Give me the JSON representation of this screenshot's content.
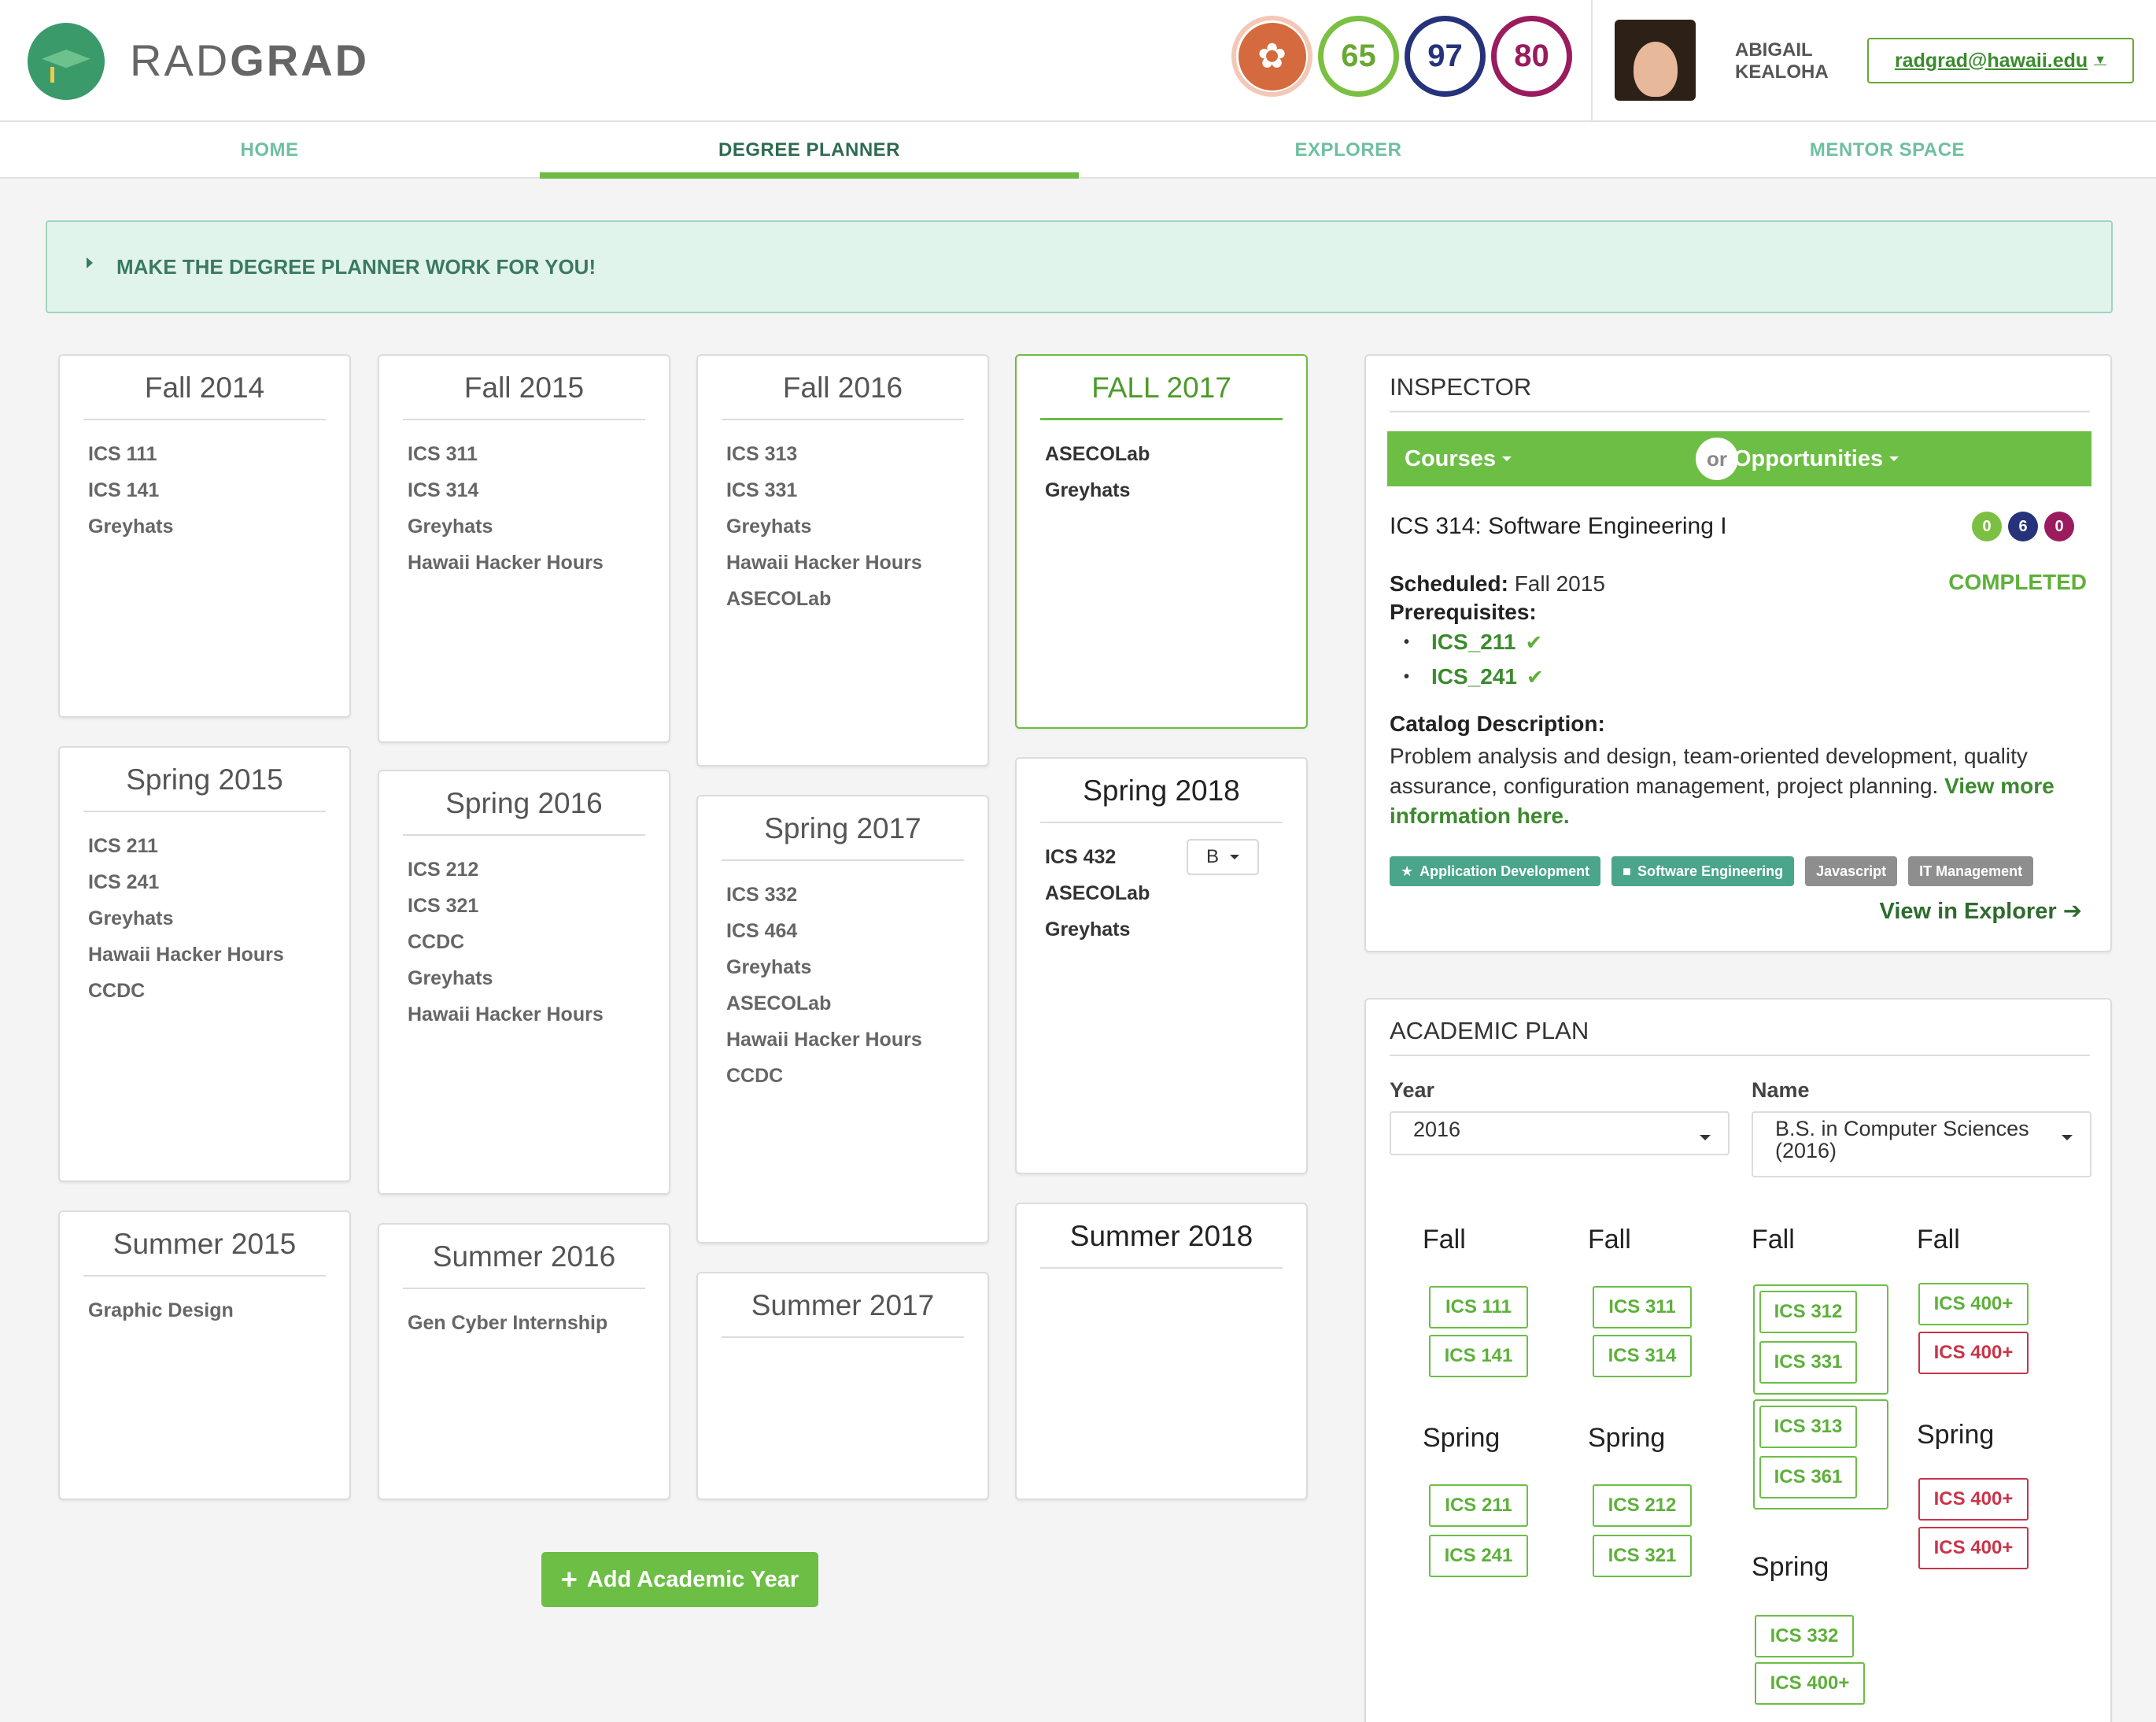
{
  "header": {
    "brand_light": "RAD",
    "brand_bold": "GRAD",
    "scores": {
      "innovation": "65",
      "competency": "97",
      "experience": "80"
    },
    "user_name": "ABIGAIL KEALOHA",
    "email": "radgrad@hawaii.edu"
  },
  "nav": [
    {
      "label": "HOME",
      "active": false
    },
    {
      "label": "DEGREE PLANNER",
      "active": true
    },
    {
      "label": "EXPLORER",
      "active": false
    },
    {
      "label": "MENTOR SPACE",
      "active": false
    }
  ],
  "banner": {
    "text": "MAKE THE DEGREE PLANNER WORK FOR YOU!"
  },
  "semesters": {
    "fall2014": {
      "title": "Fall 2014",
      "items": [
        "ICS 111",
        "ICS 141",
        "Greyhats"
      ]
    },
    "spring2015": {
      "title": "Spring 2015",
      "items": [
        "ICS 211",
        "ICS 241",
        "Greyhats",
        "Hawaii Hacker Hours",
        "CCDC"
      ]
    },
    "summer2015": {
      "title": "Summer 2015",
      "items": [
        "Graphic Design"
      ]
    },
    "fall2015": {
      "title": "Fall 2015",
      "items": [
        "ICS 311",
        "ICS 314",
        "Greyhats",
        "Hawaii Hacker Hours"
      ]
    },
    "spring2016": {
      "title": "Spring 2016",
      "items": [
        "ICS 212",
        "ICS 321",
        "CCDC",
        "Greyhats",
        "Hawaii Hacker Hours"
      ]
    },
    "summer2016": {
      "title": "Summer 2016",
      "items": [
        "Gen Cyber Internship"
      ]
    },
    "fall2016": {
      "title": "Fall 2016",
      "items": [
        "ICS 313",
        "ICS 331",
        "Greyhats",
        "Hawaii Hacker Hours",
        "ASECOLab"
      ]
    },
    "spring2017": {
      "title": "Spring 2017",
      "items": [
        "ICS 332",
        "ICS 464",
        "Greyhats",
        "ASECOLab",
        "Hawaii Hacker Hours",
        "CCDC"
      ]
    },
    "summer2017": {
      "title": "Summer 2017",
      "items": []
    },
    "fall2017": {
      "title": "FALL 2017",
      "items": [
        "ASECOLab",
        "Greyhats"
      ]
    },
    "spring2018": {
      "title": "Spring 2018",
      "items": [
        "ICS 432",
        "ASECOLab",
        "Greyhats"
      ],
      "grade": "B"
    },
    "summer2018": {
      "title": "Summer 2018",
      "items": []
    }
  },
  "add_year_label": "Add Academic Year",
  "inspector": {
    "title": "INSPECTOR",
    "tab_courses": "Courses",
    "tab_or": "or",
    "tab_opportunities": "Opportunities",
    "course_title": "ICS 314: Software Engineering I",
    "badges": [
      "0",
      "6",
      "0"
    ],
    "status": "COMPLETED",
    "scheduled_label": "Scheduled:",
    "scheduled_value": "Fall 2015",
    "prereq_label": "Prerequisites:",
    "prereqs": [
      "ICS_211",
      "ICS_241"
    ],
    "desc_label": "Catalog Description:",
    "desc_text": "Problem analysis and design, team-oriented development, quality assurance, configuration management, project planning. ",
    "desc_link": "View more information here.",
    "tags": [
      "Application Development",
      "Software Engineering",
      "Javascript",
      "IT Management"
    ],
    "view_explorer": "View in Explorer"
  },
  "plan": {
    "title": "ACADEMIC PLAN",
    "year_label": "Year",
    "year_value": "2016",
    "name_label": "Name",
    "name_value": "B.S. in Computer Sciences (2016)",
    "terms": {
      "fall": "Fall",
      "spring": "Spring"
    },
    "col1": {
      "fall": [
        "ICS 111",
        "ICS 141"
      ],
      "spring": [
        "ICS 211",
        "ICS 241"
      ]
    },
    "col2": {
      "fall": [
        "ICS 311",
        "ICS 314"
      ],
      "spring": [
        "ICS 212",
        "ICS 321"
      ]
    },
    "col3": {
      "fall_a": [
        "ICS 312",
        "ICS 331"
      ],
      "fall_b": [
        "ICS 313",
        "ICS 361"
      ],
      "spring": [
        "ICS 332",
        "ICS 400+"
      ]
    },
    "col4": {
      "fall": [
        "ICS 400+",
        "ICS 400+"
      ],
      "spring": [
        "ICS 400+",
        "ICS 400+"
      ]
    }
  },
  "colors": {
    "accent_green": "#6cbe45",
    "teal": "#6fbfa1",
    "innovation": "#7bc042",
    "competency": "#26337a",
    "experience": "#9a1b5e",
    "red": "#c9344a"
  }
}
